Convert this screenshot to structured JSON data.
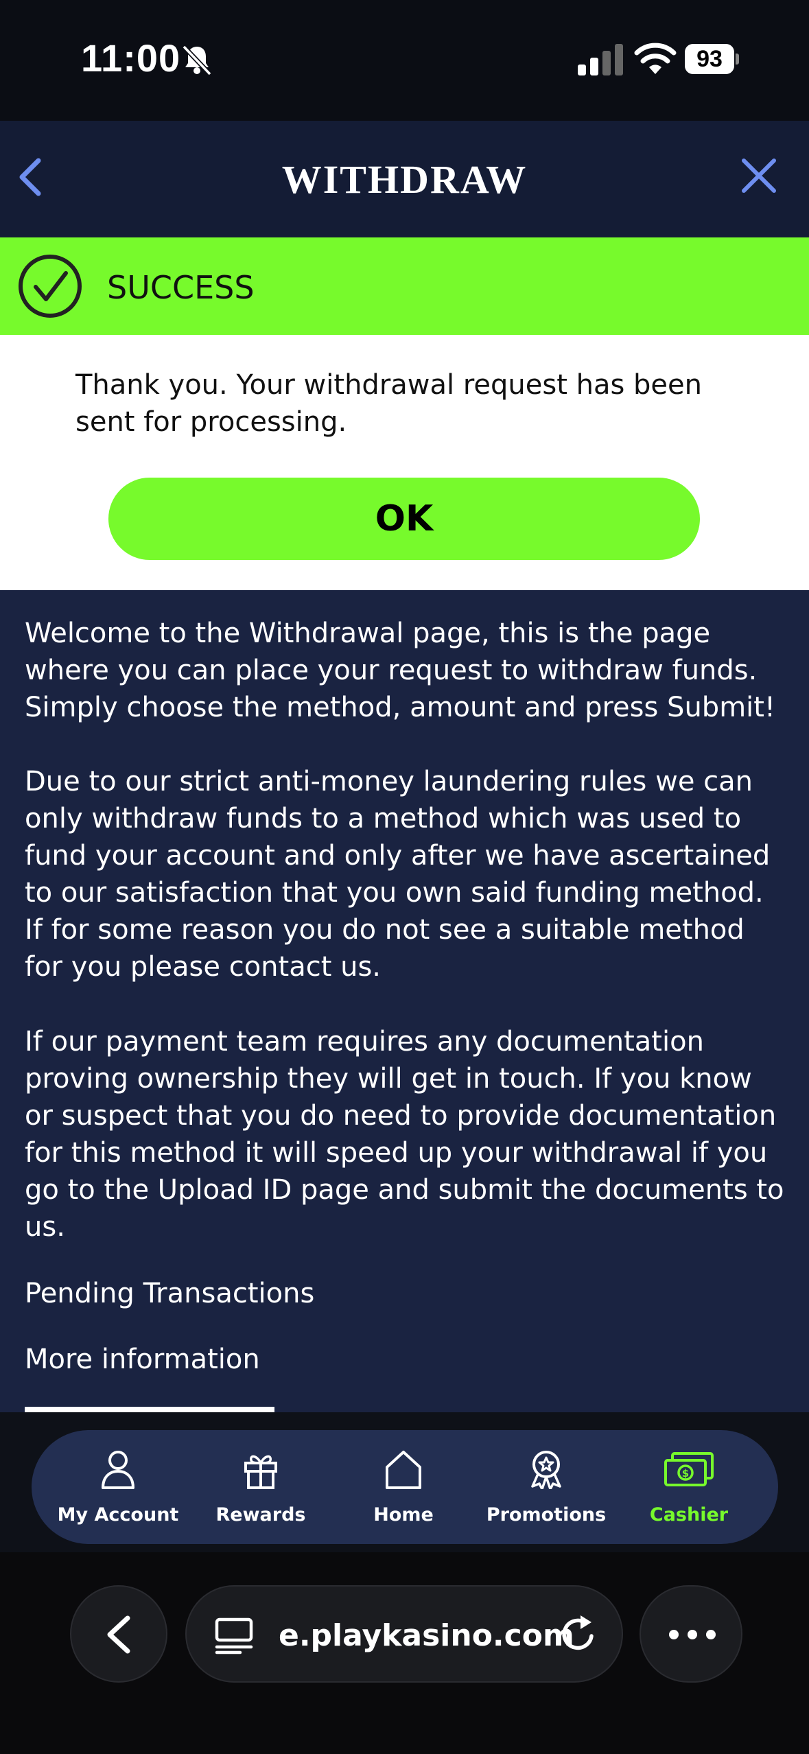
{
  "status_bar": {
    "time": "11:00",
    "battery": "93"
  },
  "header": {
    "title": "WITHDRAW"
  },
  "modal": {
    "status": "SUCCESS",
    "message": "Thank you. Your withdrawal request has been sent for processing.",
    "ok_label": "OK"
  },
  "content": {
    "paragraphs": [
      "Welcome to the Withdrawal page, this is the page where you can place your request to withdraw funds. Simply choose the method, amount and press Submit!",
      "Due to our strict anti-money laundering rules we can only withdraw funds to a method which was used to fund your account and only after we have ascertained to our satisfaction that you own said funding method. If for some reason you do not see a suitable method for you please contact us.",
      "If our payment team requires any documentation proving ownership they will get in touch. If you know or suspect that you do need to provide documentation for this method it will speed up your withdrawal if you go to the Upload ID page and submit the documents to us."
    ],
    "pending_link": "Pending Transactions",
    "more_link": "More information"
  },
  "nav": {
    "items": [
      {
        "label": "My Account",
        "icon": "user-icon"
      },
      {
        "label": "Rewards",
        "icon": "gift-icon"
      },
      {
        "label": "Home",
        "icon": "home-icon"
      },
      {
        "label": "Promotions",
        "icon": "award-icon"
      },
      {
        "label": "Cashier",
        "icon": "cash-icon",
        "active": true
      }
    ],
    "active_color": "#77fa2c"
  },
  "browser": {
    "url": "e.playkasino.com"
  },
  "colors": {
    "accent": "#77fa2c",
    "header_bg": "#141c35",
    "content_bg": "#1a2341"
  }
}
